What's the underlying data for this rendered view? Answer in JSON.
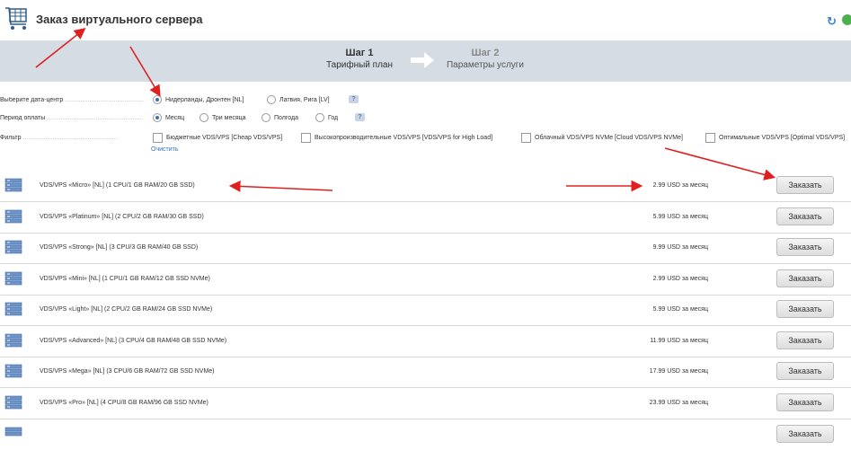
{
  "header": {
    "title": "Заказ виртуального сервера",
    "icons": [
      "cart-icon",
      "refresh-icon",
      "globe-icon"
    ]
  },
  "steps": [
    {
      "number": "Шаг 1",
      "name": "Тарифный план",
      "active": true
    },
    {
      "number": "Шаг 2",
      "name": "Параметры услуги",
      "active": false
    }
  ],
  "filters": {
    "datacenter": {
      "label": "Выберите дата-центр",
      "options": [
        "Нидерланды, Дронтен [NL]",
        "Латвия, Рига [LV]"
      ],
      "selected": "Нидерланды, Дронтен [NL]"
    },
    "period": {
      "label": "Период оплаты",
      "options": [
        "Месяц",
        "Три месяца",
        "Полгода",
        "Год"
      ],
      "selected": "Месяц"
    },
    "filter": {
      "label": "Фильтр",
      "options": [
        "Бюджетные VDS/VPS [Cheap VDS/VPS]",
        "Высокопроизводительные VDS/VPS [VDS/VPS for High Load]",
        "Облачный VDS/VPS NVMe [Cloud VDS/VPS NVMe]",
        "Оптимальные VDS/VPS [Optimal VDS/VPS]"
      ],
      "clear_label": "Очистить"
    },
    "help_label": "?"
  },
  "order_label": "Заказать",
  "tariffs": [
    {
      "name": "VDS/VPS «Micro» [NL] (1 CPU/1 GB RAM/20 GB SSD)",
      "price": "2.99 USD за месяц"
    },
    {
      "name": "VDS/VPS «Platinum» [NL] (2 CPU/2 GB RAM/30 GB SSD)",
      "price": "5.99 USD за месяц"
    },
    {
      "name": "VDS/VPS «Strong» [NL] (3 CPU/3 GB RAM/40 GB SSD)",
      "price": "9.99 USD за месяц"
    },
    {
      "name": "VDS/VPS «Mini» [NL] (1 CPU/1 GB RAM/12 GB SSD NVMe)",
      "price": "2.99 USD за месяц"
    },
    {
      "name": "VDS/VPS «Light» [NL] (2 CPU/2 GB RAM/24 GB SSD NVMe)",
      "price": "5.99 USD за месяц"
    },
    {
      "name": "VDS/VPS «Advanced» [NL] (3 CPU/4 GB RAM/48 GB SSD NVMe)",
      "price": "11.99 USD за месяц"
    },
    {
      "name": "VDS/VPS «Mega» [NL] (3 CPU/6 GB RAM/72 GB SSD NVMe)",
      "price": "17.99 USD за месяц"
    },
    {
      "name": "VDS/VPS «Pro» [NL] (4 CPU/8 GB RAM/96 GB SSD NVMe)",
      "price": "23.99 USD за месяц"
    }
  ],
  "colors": {
    "accent": "#3b6fb6",
    "steps_bar": "#d5dce3",
    "annotation": "#e02020"
  }
}
